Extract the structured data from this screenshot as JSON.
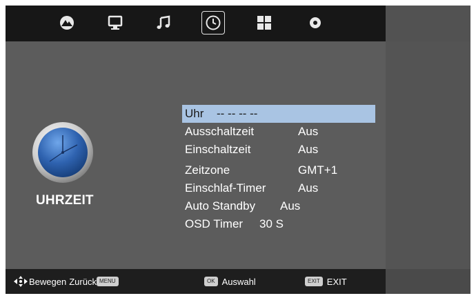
{
  "tabs": [
    {
      "name": "picture-icon"
    },
    {
      "name": "display-icon"
    },
    {
      "name": "music-icon"
    },
    {
      "name": "clock-icon",
      "selected": true
    },
    {
      "name": "grid-icon"
    },
    {
      "name": "gear-icon"
    }
  ],
  "category": {
    "title": "UHRZEIT"
  },
  "menu": {
    "items": [
      {
        "label": "Uhr",
        "value": "-- -- -- --"
      },
      {
        "label": "Ausschaltzeit",
        "value": "Aus"
      },
      {
        "label": "Einschaltzeit",
        "value": "Aus"
      },
      {
        "label": "Zeitzone",
        "value": "GMT+1"
      },
      {
        "label": "Einschlaf-Timer",
        "value": "Aus"
      },
      {
        "label": "Auto Standby",
        "value": "Aus"
      },
      {
        "label": "OSD Timer",
        "value": "30 S"
      }
    ]
  },
  "footer": {
    "move_label": "Bewegen",
    "back_label": "Zurück",
    "menu_key": "MENU",
    "ok_key": "OK",
    "select_label": "Auswahl",
    "exit_key": "EXIT",
    "exit_label": "EXIT"
  },
  "colors": {
    "highlight": "#a9c4e3",
    "clock_face": "#2f63b0"
  }
}
